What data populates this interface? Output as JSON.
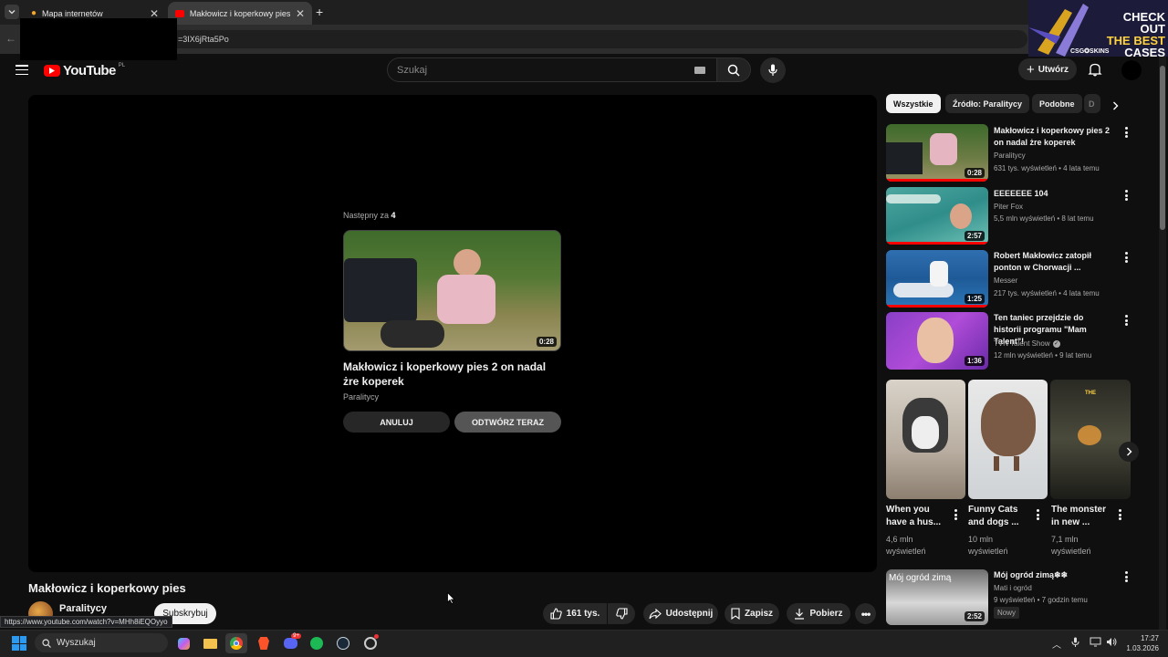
{
  "browser": {
    "tabs": [
      {
        "title": "Mapa internetów"
      },
      {
        "title": "Makłowicz i koperkowy pies - Y"
      }
    ],
    "new_tab": "+",
    "url_fragment": "=3IX6jRta5Po",
    "status_url": "https://www.youtube.com/watch?v=MHh8iEQOyyo"
  },
  "promo": {
    "line1": "CHECK OUT",
    "line2": "THE BEST",
    "line3": "CASES",
    "brand": "CSG✪SKINS"
  },
  "youtube": {
    "logo_text": "YouTube",
    "region": "PL",
    "search_placeholder": "Szukaj",
    "create_label": "Utwórz"
  },
  "endscreen": {
    "next_prefix": "Następny za",
    "countdown": "4",
    "video_title": "Makłowicz i koperkowy pies 2 on nadal żre koperek",
    "channel": "Paralitycy",
    "duration": "0:28",
    "cancel_label": "ANULUJ",
    "play_label": "ODTWÓRZ TERAZ"
  },
  "video": {
    "title": "Makłowicz i koperkowy pies",
    "channel": "Paralitycy",
    "subscribe_label": "Subskrybuj",
    "likes": "161 tys.",
    "share_label": "Udostępnij",
    "save_label": "Zapisz",
    "download_label": "Pobierz"
  },
  "chips": [
    "Wszystkie",
    "Źródło: Paralitycy",
    "Podobne",
    "D"
  ],
  "recommendations": [
    {
      "title": "Makłowicz i koperkowy pies 2 on nadal żre koperek",
      "channel": "Paralitycy",
      "meta": "631 tys. wyświetleń • 4 lata temu",
      "duration": "0:28",
      "watched": 1.0
    },
    {
      "title": "EEEEEEE 104",
      "channel": "Piter Fox",
      "meta": "5,5 mln wyświetleń • 8 lat temu",
      "duration": "2:57",
      "watched": 1.0
    },
    {
      "title": "Robert Makłowicz zatopił ponton w Chorwacji  ...",
      "channel": "Messer",
      "meta": "217 tys. wyświetleń • 4 lata temu",
      "duration": "1:25",
      "watched": 1.0
    },
    {
      "title": "Ten taniec przejdzie do historii programu \"Mam Talent\"!",
      "channel": "TVN Talent Show",
      "meta": "12 mln wyświetleń • 9 lat temu",
      "duration": "1:36",
      "watched": 0
    }
  ],
  "shorts": [
    {
      "title": "When you have a hus...",
      "views": "4,6 mln",
      "views_label": "wyświetleń"
    },
    {
      "title": "Funny Cats and dogs ...",
      "views": "10 mln",
      "views_label": "wyświetleń"
    },
    {
      "title": "The monster in new ...",
      "views": "7,1 mln",
      "views_label": "wyświetleń",
      "overlay": "THE"
    }
  ],
  "last_rec": {
    "title": "Mój ogród zimą❄❄",
    "channel": "Mati i ogród",
    "meta": "9 wyświetleń • 7 godzin temu",
    "badge": "Nowy",
    "duration": "2:52",
    "thumb_text": "Mój ogród zimą"
  },
  "taskbar": {
    "search_placeholder": "Wyszukaj",
    "time": "17:27",
    "date": "1.03.2026",
    "discord_badge": "9+"
  }
}
